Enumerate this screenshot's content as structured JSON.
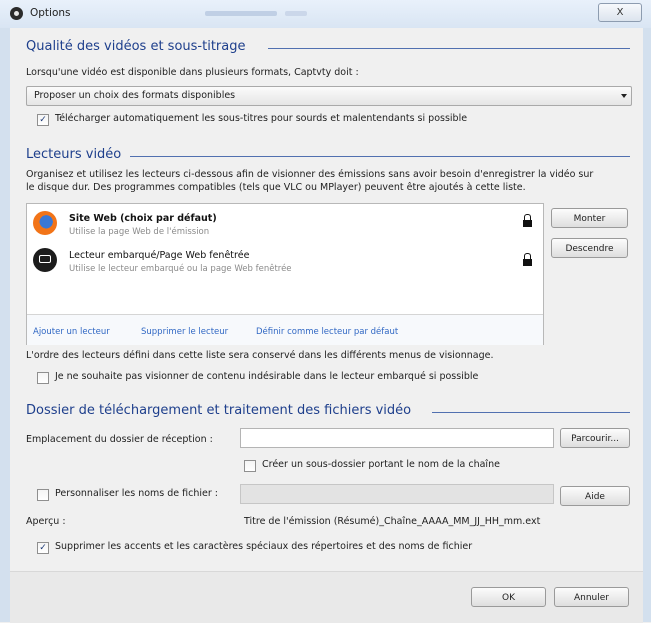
{
  "window": {
    "title": "Options",
    "close_label": "X"
  },
  "video_quality": {
    "title": "Qualité des vidéos et sous-titrage",
    "format_prompt": "Lorsqu'une vidéo est disponible dans plusieurs formats, Captvty doit :",
    "format_selected": "Proposer un choix des formats disponibles",
    "subtitles_label": "Télécharger automatiquement les sous-titres pour sourds et malentendants si possible",
    "subtitles_checked": true
  },
  "players": {
    "title": "Lecteurs vidéo",
    "description_line1": "Organisez et utilisez les lecteurs ci-dessous afin de visionner des émissions sans avoir besoin d'enregistrer la vidéo sur",
    "description_line2": "le disque dur. Des programmes compatibles (tels que VLC ou MPlayer) peuvent être ajoutés à cette liste.",
    "items": [
      {
        "title": "Site Web (choix par défaut)",
        "subtitle": "Utilise la page Web de l'émission",
        "icon": "firefox-icon",
        "locked": true
      },
      {
        "title": "Lecteur embarqué/Page Web fenêtrée",
        "subtitle": "Utilise le lecteur embarqué ou la page Web fenêtrée",
        "icon": "player-icon",
        "locked": true
      }
    ],
    "links": {
      "add": "Ajouter un lecteur",
      "remove": "Supprimer le lecteur",
      "default": "Définir comme lecteur par défaut"
    },
    "move_up": "Monter",
    "move_down": "Descendre",
    "order_note": "L'ordre des lecteurs défini dans cette liste sera conservé dans les différents menus de visionnage.",
    "no_undesirable_label": "Je ne souhaite pas visionner de contenu indésirable dans le lecteur embarqué si possible",
    "no_undesirable_checked": false
  },
  "download": {
    "title": "Dossier de téléchargement et traitement des fichiers vidéo",
    "folder_label": "Emplacement du dossier de réception :",
    "folder_value": "",
    "browse_label": "Parcourir...",
    "subfolder_label": "Créer un sous-dossier portant le nom de la chaîne",
    "subfolder_checked": false,
    "customize_label": "Personnaliser les noms de fichier :",
    "customize_checked": false,
    "customize_value": "",
    "help_label": "Aide",
    "preview_label": "Aperçu :",
    "preview_value": "Titre de l'émission (Résumé)_Chaîne_AAAA_MM_JJ_HH_mm.ext",
    "strip_accents_label": "Supprimer les accents et les caractères spéciaux des répertoires et des noms de fichier",
    "strip_accents_checked": true
  },
  "footer": {
    "ok_label": "OK",
    "cancel_label": "Annuler"
  },
  "colors": {
    "section_title": "#1e3f8c",
    "link": "#3168c4",
    "titlebar": "#dce7f4"
  }
}
